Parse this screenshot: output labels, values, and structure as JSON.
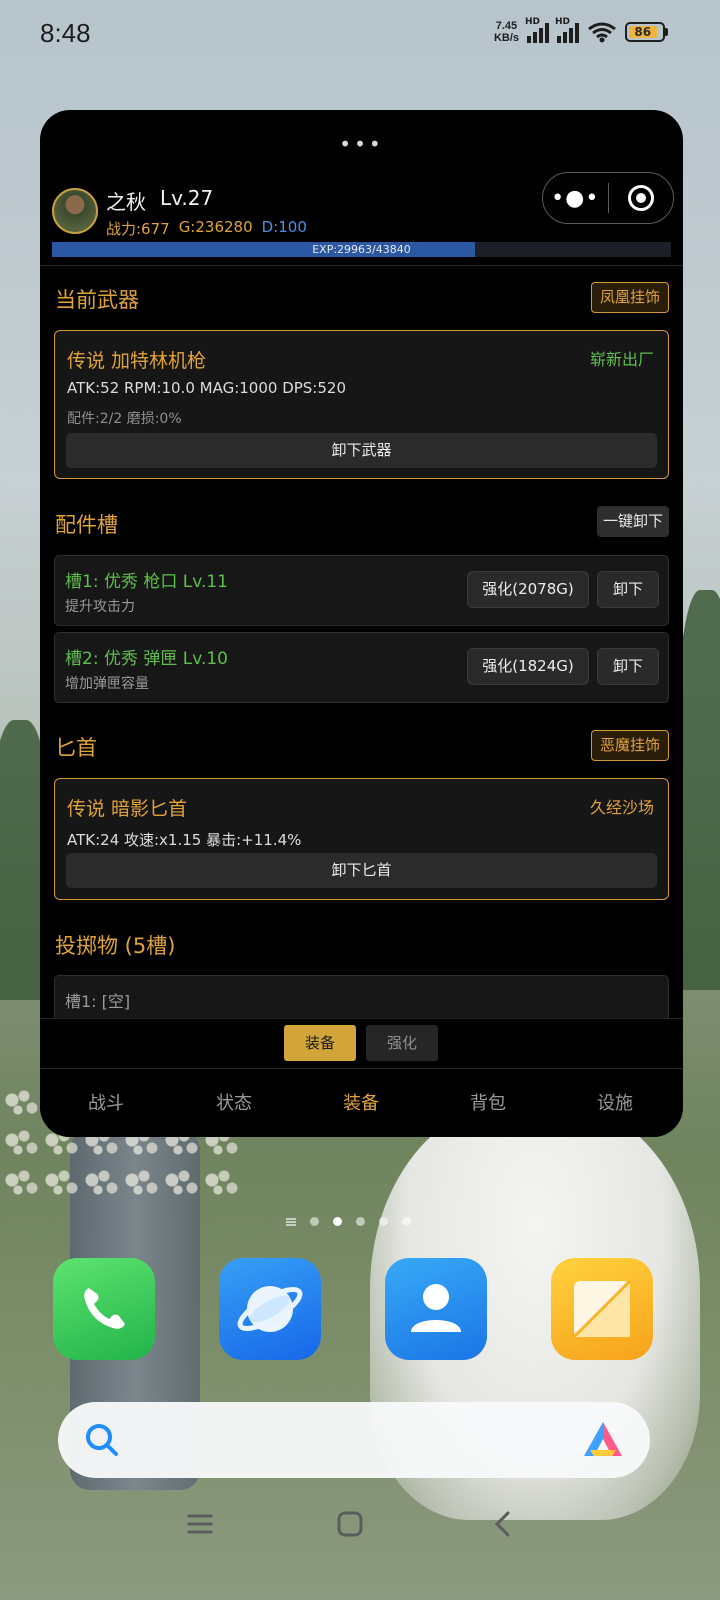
{
  "status_bar": {
    "time": "8:48",
    "net_speed_value": "7.45",
    "net_speed_unit": "KB/s",
    "signal_label": "HD",
    "battery": "86",
    "battery_level": 0.86
  },
  "app": {
    "drag_handle": "•••",
    "capsule_more": "•●•",
    "player": {
      "name": "之秋",
      "level": "Lv.27",
      "power": "战力:677",
      "gold": "G:236280",
      "diamond": "D:100"
    },
    "exp": {
      "text": "EXP:29963/43840",
      "fraction": 0.683
    },
    "current_weapon": {
      "section_title": "当前武器",
      "skin_tag": "凤凰挂饰",
      "name": "传说 加特林机枪",
      "condition": "崭新出厂",
      "stats": "ATK:52  RPM:10.0  MAG:1000  DPS:520",
      "sub": "配件:2/2  磨损:0%",
      "unequip_label": "卸下武器"
    },
    "attachments": {
      "section_title": "配件槽",
      "unequip_all_label": "一键卸下",
      "slots": [
        {
          "title": "槽1: 优秀 枪口 Lv.11",
          "desc": "提升攻击力",
          "upgrade_label": "强化(2078G)",
          "remove_label": "卸下"
        },
        {
          "title": "槽2: 优秀 弹匣 Lv.10",
          "desc": "增加弹匣容量",
          "upgrade_label": "强化(1824G)",
          "remove_label": "卸下"
        }
      ]
    },
    "dagger": {
      "section_title": "匕首",
      "skin_tag": "恶魔挂饰",
      "name": "传说 暗影匕首",
      "condition": "久经沙场",
      "stats": "ATK:24  攻速:x1.15  暴击:+11.4%",
      "unequip_label": "卸下匕首"
    },
    "throwables": {
      "section_title": "投掷物 (5槽)",
      "slot1": "槽1: [空]"
    },
    "sub_tabs": {
      "equip": "装备",
      "upgrade": "强化"
    },
    "nav": {
      "battle": "战斗",
      "status": "状态",
      "equipment": "装备",
      "bag": "背包",
      "facility": "设施"
    }
  },
  "colors": {
    "accent_gold": "#e0a33a",
    "rarity_good": "#5fbe4d",
    "condition_new": "#5fbe4d",
    "condition_worn": "#e0a33a",
    "diamond_blue": "#4d8fe6",
    "exp_blue": "#2b58a3"
  },
  "home": {
    "dock": [
      "phone-icon",
      "browser-icon",
      "contacts-icon",
      "notes-icon"
    ]
  }
}
